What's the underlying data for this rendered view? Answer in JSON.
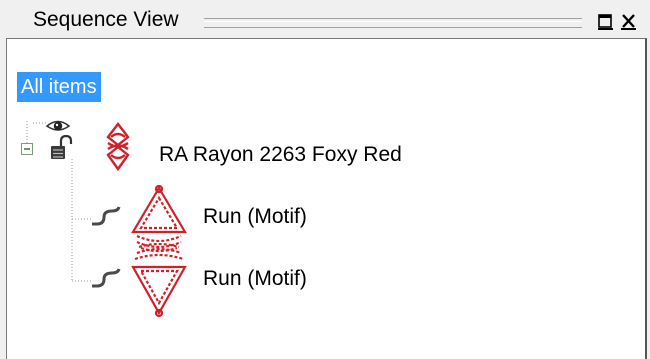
{
  "window": {
    "title": "Sequence View"
  },
  "tree": {
    "root_label": "All items",
    "items": [
      {
        "label": "RA Rayon 2263 Foxy Red",
        "expanded": true
      },
      {
        "label": "Run (Motif)"
      },
      {
        "label": "Run (Motif)"
      }
    ]
  },
  "colors": {
    "selection": "#3399ff",
    "thread": "#d0202a"
  }
}
